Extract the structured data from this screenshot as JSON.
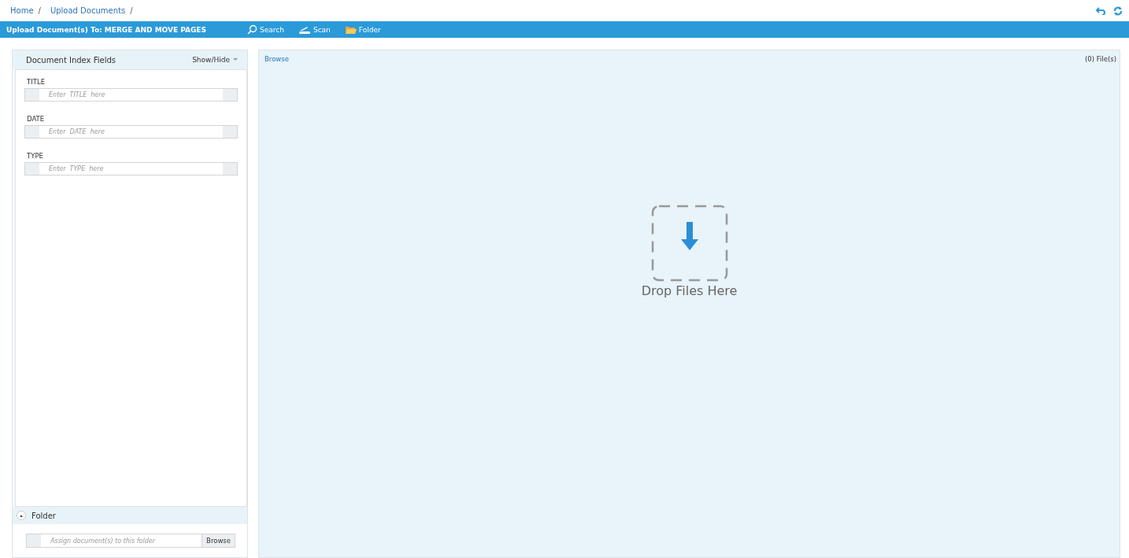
{
  "breadcrumb": [
    {
      "label": "Home",
      "separator": "/"
    },
    {
      "label": "Upload Documents",
      "separator": "/"
    }
  ],
  "toolbar": {
    "title": "Upload Document(s) To:  MERGE AND MOVE PAGES",
    "actions": [
      {
        "kind": "search",
        "label": "Search"
      },
      {
        "kind": "scan",
        "label": "Scan"
      },
      {
        "kind": "folder",
        "label": "Folder"
      }
    ]
  },
  "index_panel": {
    "title": "Document Index Fields",
    "toggle": "Show/Hide",
    "fields": [
      {
        "label": "TITLE",
        "placeholder": "Enter  TITLE  here"
      },
      {
        "label": "DATE",
        "placeholder": "Enter  DATE  here"
      },
      {
        "label": "TYPE",
        "placeholder": "Enter  TYPE  here"
      }
    ]
  },
  "folder_section": {
    "title": "Folder",
    "expanded": true,
    "placeholder": "Assign document(s) to this folder",
    "button": "Browse"
  },
  "drop_area": {
    "browse": "Browse",
    "file_count": "(0) File(s)",
    "prompt": "Drop Files Here"
  }
}
